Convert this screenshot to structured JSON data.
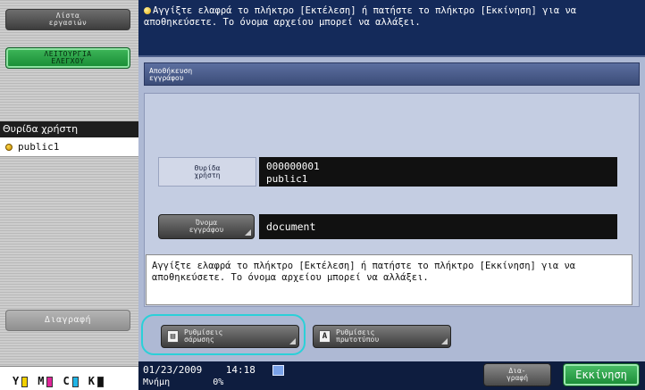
{
  "left_panel": {
    "job_list_button": "Λίστα\nεργασιών",
    "utility_button": "ΛΕΙΤΟΥΡΓΙΑ\nΕΛΕΓΧΟΥ",
    "box_header": "Θυρίδα χρήστη",
    "box_item": "public1",
    "delete_button": "Διαγραφή",
    "toner": [
      {
        "label": "Y",
        "color": "#f2d000",
        "level": 0.55
      },
      {
        "label": "M",
        "color": "#e0259a",
        "level": 0.55
      },
      {
        "label": "C",
        "color": "#20b5e6",
        "level": 0.55
      },
      {
        "label": "K",
        "color": "#111111",
        "level": 0.55
      }
    ]
  },
  "top_message": "Αγγίξτε ελαφρά το πλήκτρο [Εκτέλεση] ή πατήστε το πλήκτρο [Εκκίνηση] για να αποθηκεύσετε. Το όνομα αρχείου μπορεί να αλλάξει.",
  "dialog": {
    "title": "Αποθήκευση\nεγγράφου",
    "user_box_label": "Θυρίδα\nχρήστη",
    "user_box_number": "000000001",
    "user_box_name": "public1",
    "document_name_button": "Όνομα\nεγγράφου",
    "document_name_value": "document",
    "message": "Αγγίξτε ελαφρά το πλήκτρο [Εκτέλεση] ή πατήστε το πλήκτρο [Εκκίνηση] για να αποθηκεύσετε. Το όνομα αρχείου μπορεί να αλλάξει.",
    "scan_settings_button": "Ρυθμίσεις\nσάρωσης",
    "original_settings_button": "Ρυθμίσεις\nπρωτοτύπου"
  },
  "status_bar": {
    "date": "01/23/2009",
    "time": "14:18",
    "memory_label": "Μνήμη",
    "memory_value": "0%",
    "cancel_button": "Δια-\nγραφή",
    "start_button": "Εκκίνηση"
  }
}
